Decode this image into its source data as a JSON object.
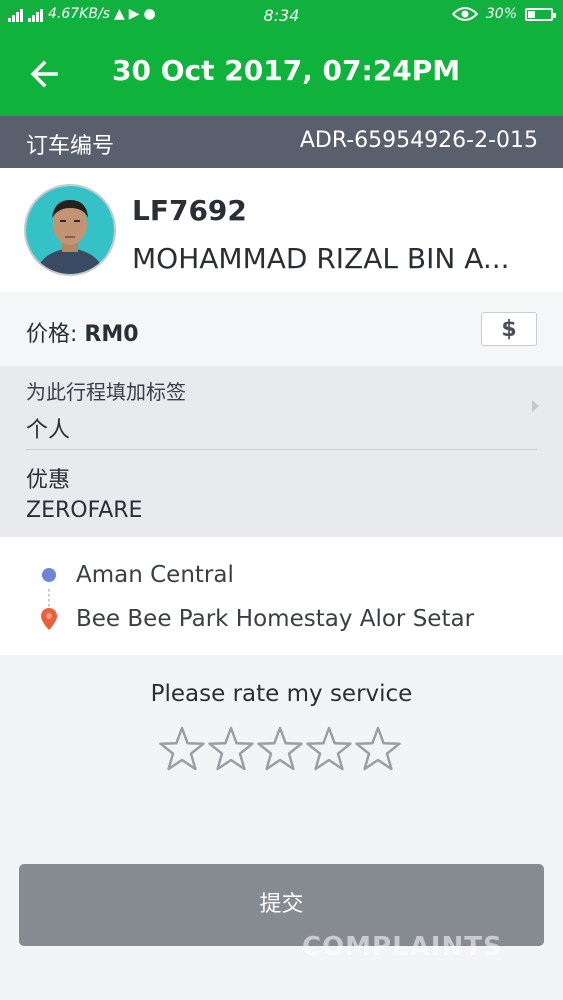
{
  "status_bar": {
    "network_speed": "4.67KB/s",
    "time": "8:34",
    "battery": "30%",
    "battery_level": 0.3
  },
  "app_bar": {
    "title": "30 Oct 2017, 07:24PM"
  },
  "booking": {
    "label": "订车编号",
    "code": "ADR-65954926-2-015"
  },
  "driver": {
    "plate": "LF7692",
    "name": "MOHAMMAD RIZAL BIN A..."
  },
  "price": {
    "label": "价格:",
    "value": "RM0",
    "currency_symbol": "$"
  },
  "trip_tag": {
    "label": "为此行程填加标签",
    "value": "个人"
  },
  "promo": {
    "label": "优惠",
    "value": "ZEROFARE"
  },
  "route": {
    "pickup": "Aman Central",
    "dropoff": "Bee Bee Park Homestay Alor Setar",
    "pickup_color": "#6f84d8",
    "dropoff_color": "#e8603c"
  },
  "rating": {
    "prompt": "Please rate my service",
    "stars_total": 5,
    "stars_selected": 0
  },
  "submit": {
    "label": "提交"
  },
  "watermark": {
    "text": "COMPLAINTS"
  },
  "colors": {
    "brand_green": "#0fb33c",
    "booking_bar": "#595f6c",
    "submit_button": "#868a91"
  }
}
